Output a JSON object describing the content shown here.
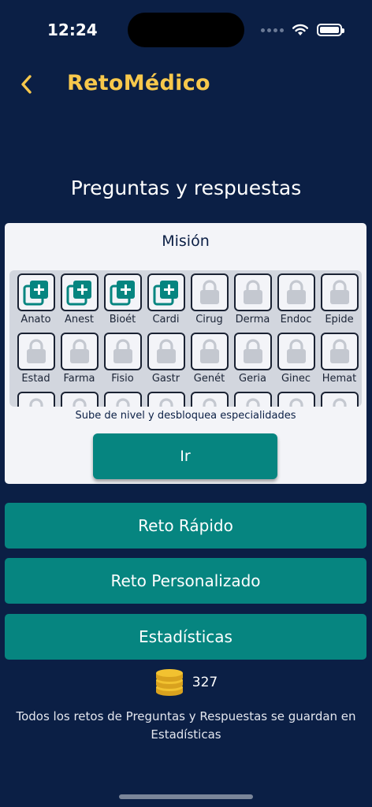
{
  "status_bar": {
    "time": "12:24"
  },
  "nav": {
    "title": "RetoMédico"
  },
  "section_title": "Preguntas y respuestas",
  "mission": {
    "title": "Misión",
    "hint": "Sube de nivel y desbloquea especialidades",
    "go_label": "Ir",
    "specialties": [
      {
        "label": "Anato",
        "unlocked": true
      },
      {
        "label": "Anest",
        "unlocked": true
      },
      {
        "label": "Bioét",
        "unlocked": true
      },
      {
        "label": "Cardi",
        "unlocked": true
      },
      {
        "label": "Cirug",
        "unlocked": false
      },
      {
        "label": "Derma",
        "unlocked": false
      },
      {
        "label": "Endoc",
        "unlocked": false
      },
      {
        "label": "Epide",
        "unlocked": false
      },
      {
        "label": "Estad",
        "unlocked": false
      },
      {
        "label": "Farma",
        "unlocked": false
      },
      {
        "label": "Fisio",
        "unlocked": false
      },
      {
        "label": "Gastr",
        "unlocked": false
      },
      {
        "label": "Genét",
        "unlocked": false
      },
      {
        "label": "Geria",
        "unlocked": false
      },
      {
        "label": "Ginec",
        "unlocked": false
      },
      {
        "label": "Hemat",
        "unlocked": false
      },
      {
        "label": "",
        "unlocked": false
      },
      {
        "label": "",
        "unlocked": false
      },
      {
        "label": "",
        "unlocked": false
      },
      {
        "label": "",
        "unlocked": false
      },
      {
        "label": "",
        "unlocked": false
      },
      {
        "label": "",
        "unlocked": false
      },
      {
        "label": "",
        "unlocked": false
      },
      {
        "label": "",
        "unlocked": false
      }
    ]
  },
  "menu": {
    "quick_label": "Reto Rápido",
    "custom_label": "Reto Personalizado",
    "stats_label": "Estadísticas"
  },
  "coins": {
    "count": "327"
  },
  "footnote": "Todos los retos de Preguntas y Respuestas se guardan en Estadísticas",
  "colors": {
    "background": "#0b1f45",
    "accent": "#068580",
    "title": "#f7c84c",
    "card": "#f3f4f8",
    "coin": "#f2c230"
  },
  "icons": {
    "unlocked": "medical-cards-icon",
    "locked": "lock-icon",
    "back": "chevron-left-icon",
    "coins": "coin-stack-icon"
  }
}
